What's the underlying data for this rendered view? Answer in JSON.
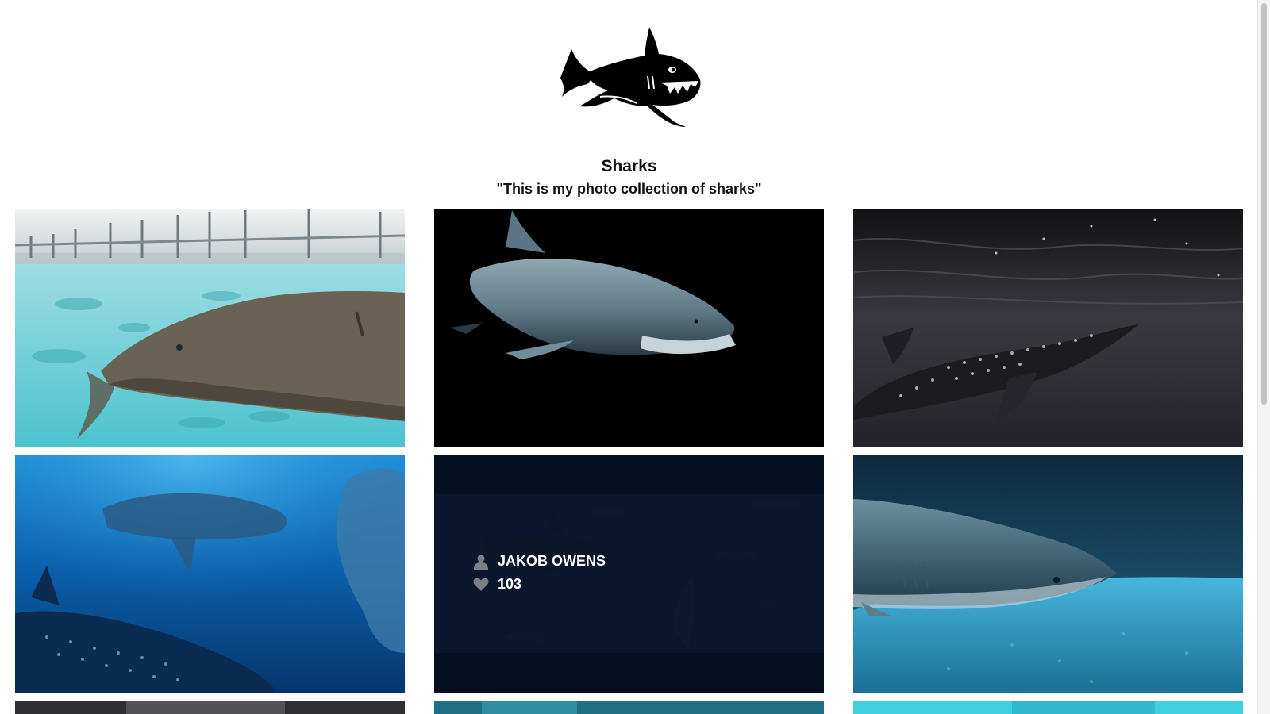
{
  "header": {
    "title": "Sharks",
    "subtitle": "\"This is my photo collection of sharks\"",
    "logo": "shark-logo"
  },
  "gallery": {
    "tiles": [
      {
        "scene": "nurse-shark-split-view"
      },
      {
        "scene": "shark-dark-background"
      },
      {
        "scene": "whale-shark-dark-water"
      },
      {
        "scene": "whale-sharks-blue"
      },
      {
        "scene": "sharks-dark-blue",
        "hover": true,
        "author": "JAKOB OWENS",
        "likes": "103"
      },
      {
        "scene": "shark-over-sand"
      }
    ]
  },
  "colors": {
    "turquoise": "#4fc6cf",
    "deep_blue": "#0b4f8e",
    "dark": "#000000",
    "overlay": "#020814"
  }
}
